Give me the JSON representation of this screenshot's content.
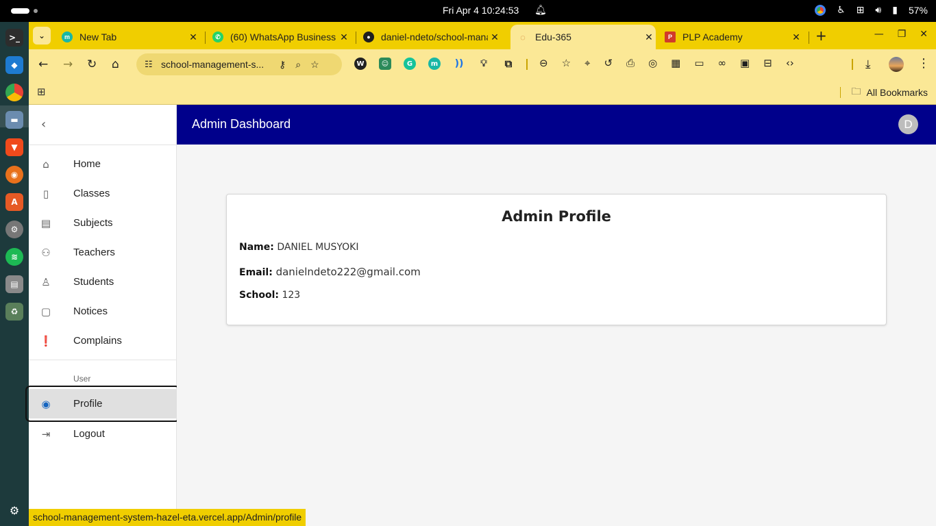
{
  "system": {
    "clock": "Fri Apr 4  10:24:53",
    "battery": "57%"
  },
  "tabs": [
    {
      "title": "New Tab",
      "favicon": "m",
      "color": "#19b7a5",
      "active": false
    },
    {
      "title": "(60) WhatsApp Business",
      "favicon": "whatsapp-icon",
      "color": "#25d366",
      "active": false
    },
    {
      "title": "daniel-ndeto/school-management",
      "favicon": "github-icon",
      "color": "#1f1f1f",
      "active": false
    },
    {
      "title": "Edu-365",
      "favicon": "loading-icon",
      "color": "#d07a30",
      "active": true
    },
    {
      "title": "PLP Academy",
      "favicon": "plp-icon",
      "color": "#d13b2a",
      "active": false
    }
  ],
  "toolbar": {
    "url": "school-management-system-hazel-eta.vercel.app/Admin/profile",
    "url_display": "school-management-s..."
  },
  "bookmarks": {
    "all_label": "All Bookmarks"
  },
  "app": {
    "header_title": "Admin Dashboard",
    "avatar_letter": "D",
    "accent": "#00008b"
  },
  "sidebar": {
    "items": [
      {
        "label": "Home",
        "icon": "home-icon"
      },
      {
        "label": "Classes",
        "icon": "class-icon"
      },
      {
        "label": "Subjects",
        "icon": "assignment-icon"
      },
      {
        "label": "Teachers",
        "icon": "supervisor-icon"
      },
      {
        "label": "Students",
        "icon": "person-icon"
      },
      {
        "label": "Notices",
        "icon": "announcement-icon"
      },
      {
        "label": "Complains",
        "icon": "report-icon"
      }
    ],
    "section_label": "User",
    "user_items": [
      {
        "label": "Profile",
        "icon": "account-circle-icon",
        "selected": true
      },
      {
        "label": "Logout",
        "icon": "exit-icon"
      }
    ]
  },
  "profile": {
    "heading": "Admin Profile",
    "name_label": "Name:",
    "name": "DANIEL MUSYOKI",
    "email_label": "Email:",
    "email": "danielndeto222@gmail.com",
    "school_label": "School:",
    "school": "123"
  },
  "status_bar": {
    "url": "school-management-system-hazel-eta.vercel.app/Admin/profile"
  }
}
